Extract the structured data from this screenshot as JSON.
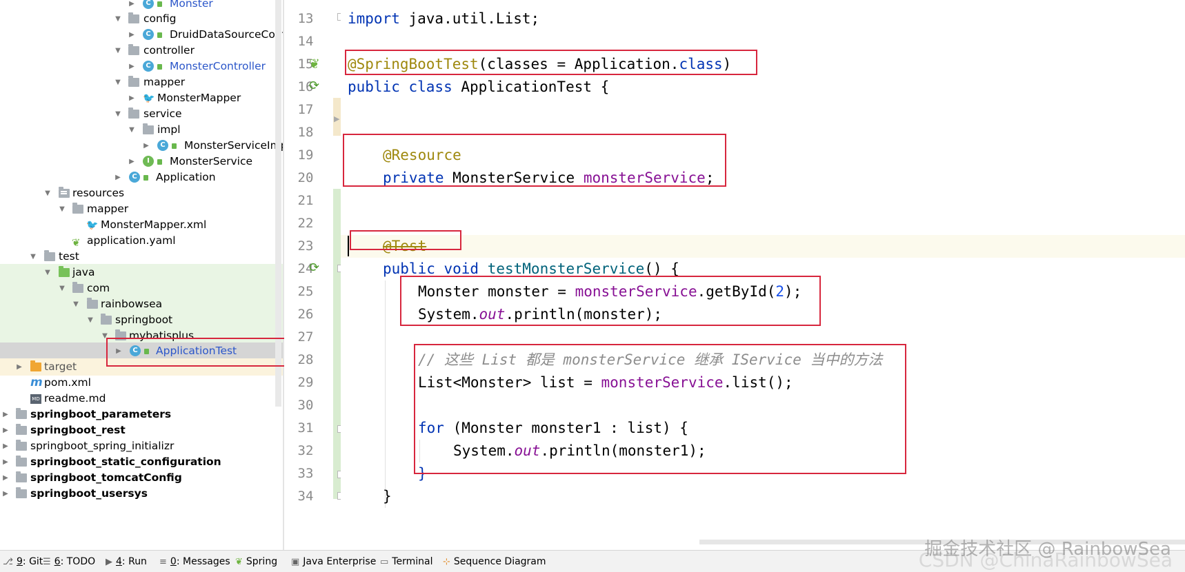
{
  "project_tree": {
    "items": [
      {
        "label": "Monster",
        "kind": "class"
      },
      {
        "label": "config",
        "kind": "folder"
      },
      {
        "label": "DruidDataSourceConfi",
        "kind": "class"
      },
      {
        "label": "controller",
        "kind": "folder"
      },
      {
        "label": "MonsterController",
        "kind": "class"
      },
      {
        "label": "mapper",
        "kind": "folder"
      },
      {
        "label": "MonsterMapper",
        "kind": "mybatis"
      },
      {
        "label": "service",
        "kind": "folder"
      },
      {
        "label": "impl",
        "kind": "folder"
      },
      {
        "label": "MonsterServiceImp",
        "kind": "class"
      },
      {
        "label": "MonsterService",
        "kind": "interface"
      },
      {
        "label": "Application",
        "kind": "app"
      },
      {
        "label": "resources",
        "kind": "folder"
      },
      {
        "label": "mapper",
        "kind": "folder"
      },
      {
        "label": "MonsterMapper.xml",
        "kind": "mybatis"
      },
      {
        "label": "application.yaml",
        "kind": "spring"
      },
      {
        "label": "test",
        "kind": "folder"
      },
      {
        "label": "java",
        "kind": "folder"
      },
      {
        "label": "com",
        "kind": "folder"
      },
      {
        "label": "rainbowsea",
        "kind": "folder"
      },
      {
        "label": "springboot",
        "kind": "folder"
      },
      {
        "label": "mybatisplus",
        "kind": "folder"
      },
      {
        "label": "ApplicationTest",
        "kind": "app"
      },
      {
        "label": "target",
        "kind": "folder"
      },
      {
        "label": "pom.xml",
        "kind": "maven"
      },
      {
        "label": "readme.md",
        "kind": "markdown"
      },
      {
        "label": "springboot_parameters",
        "kind": "module"
      },
      {
        "label": "springboot_rest",
        "kind": "module"
      },
      {
        "label": "springboot_spring_initializr",
        "kind": "module"
      },
      {
        "label": "springboot_static_configuration",
        "kind": "module"
      },
      {
        "label": "springboot_tomcatConfig",
        "kind": "module"
      },
      {
        "label": "springboot_usersys",
        "kind": "module"
      }
    ]
  },
  "editor": {
    "line_numbers": [
      "13",
      "14",
      "15",
      "16",
      "17",
      "18",
      "19",
      "20",
      "21",
      "22",
      "23",
      "24",
      "25",
      "26",
      "27",
      "28",
      "29",
      "30",
      "31",
      "32",
      "33",
      "34"
    ],
    "code": {
      "l13_kw": "import",
      "l13_rest": " java.util.List;",
      "l15_ann": "@SpringBootTest",
      "l15_rest": "(classes = Application.",
      "l15_kw": "class",
      "l15_close": ")",
      "l16_kw": "public class",
      "l16_rest": " ApplicationTest {",
      "l19_ann": "@Resource",
      "l20_kw": "private",
      "l20_type": " MonsterService ",
      "l20_fld": "monsterService",
      "l20_end": ";",
      "l23_ann": "@Test",
      "l24_kw": "public void",
      "l24_name": " testMonsterService",
      "l24_rest": "() {",
      "l25_a": "Monster monster = ",
      "l25_fld": "monsterService",
      "l25_b": ".getById(",
      "l25_num": "2",
      "l25_c": ");",
      "l26_a": "System.",
      "l26_static": "out",
      "l26_b": ".println(monster);",
      "l28_cmt": "// 这些 List 都是 monsterService 继承 IService 当中的方法",
      "l29_a": "List<Monster> list = ",
      "l29_fld": "monsterService",
      "l29_b": ".list();",
      "l31_kw": "for",
      "l31_rest": " (Monster monster1 : list) {",
      "l32_a": "System.",
      "l32_static": "out",
      "l32_b": ".println(monster1);",
      "l33_brace": "}",
      "l34_brace": "}"
    }
  },
  "toolbar": {
    "git": {
      "key": "9",
      "label": ": Git"
    },
    "todo": {
      "key": "6",
      "label": ": TODO"
    },
    "run": {
      "key": "4",
      "label": ": Run"
    },
    "messages": {
      "key": "0",
      "label": ": Messages"
    },
    "spring": "Spring",
    "java_enterprise": "Java Enterprise",
    "terminal": "Terminal",
    "sequence_diagram": "Sequence Diagram"
  },
  "watermark": {
    "text": "掘金技术社区 @ RainbowSea",
    "text2": "CSDN @ChinaRainbowSea"
  },
  "colors": {
    "keyword": "#0033b3",
    "annotation": "#9e880d",
    "field": "#871094",
    "number": "#1750eb",
    "comment": "#8c8c8c",
    "highlight_box": "#d7263d"
  }
}
